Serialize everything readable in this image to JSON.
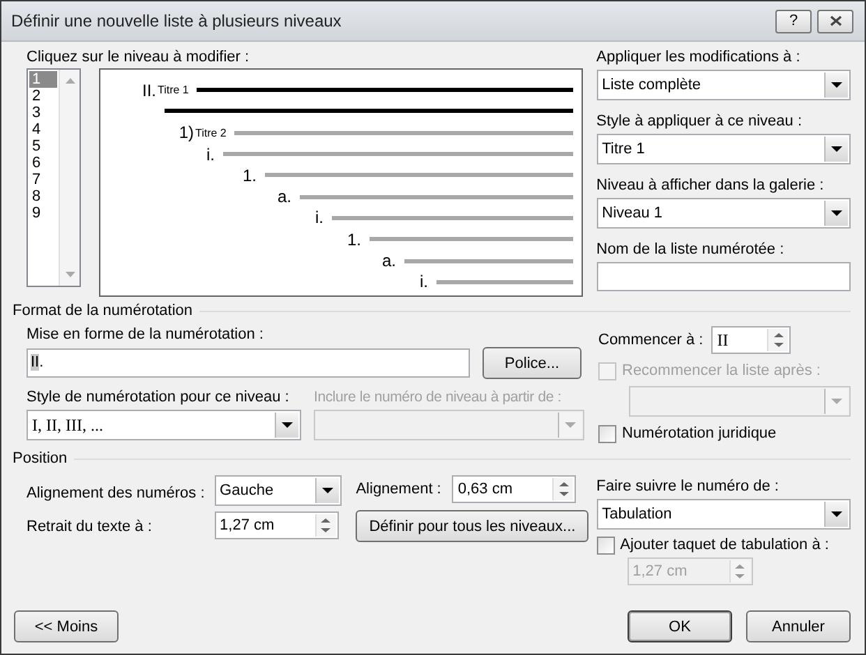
{
  "window": {
    "title": "Définir une nouvelle liste à plusieurs niveaux",
    "help": "?"
  },
  "level_list": {
    "label": "Cliquez sur le niveau à modifier :",
    "items": [
      {
        "label": "1",
        "selected": true
      },
      {
        "label": "2",
        "selected": false
      },
      {
        "label": "3",
        "selected": false
      },
      {
        "label": "4",
        "selected": false
      },
      {
        "label": "5",
        "selected": false
      },
      {
        "label": "6",
        "selected": false
      },
      {
        "label": "7",
        "selected": false
      },
      {
        "label": "8",
        "selected": false
      },
      {
        "label": "9",
        "selected": false
      }
    ]
  },
  "preview": {
    "levels": [
      {
        "number": "II.",
        "title": "Titre 1",
        "selected": true
      },
      {
        "number": "1)",
        "title": "Titre 2",
        "selected": false
      },
      {
        "number": "i.",
        "selected": false
      },
      {
        "number": "1.",
        "selected": false
      },
      {
        "number": "a.",
        "selected": false
      },
      {
        "number": "i.",
        "selected": false
      },
      {
        "number": "1.",
        "selected": false
      },
      {
        "number": "a.",
        "selected": false
      },
      {
        "number": "i.",
        "selected": false
      }
    ]
  },
  "apply_to": {
    "label": "Appliquer les modifications à :",
    "value": "Liste complète"
  },
  "level_style": {
    "label": "Style à appliquer à ce niveau :",
    "value": "Titre 1"
  },
  "gallery_level": {
    "label": "Niveau à afficher dans la galerie :",
    "value": "Niveau 1"
  },
  "list_name": {
    "label": "Nom de la liste numérotée :"
  },
  "number_format": {
    "title": "Format de la numérotation",
    "format": {
      "label": "Mise en forme de la numérotation :",
      "field": "II",
      "text": "."
    },
    "font_button": "Police...",
    "style": {
      "label": "Style de numérotation pour ce niveau :",
      "value": "I, II, III, ..."
    },
    "include": {
      "label": "Inclure le numéro de niveau à partir de :",
      "disabled": true
    },
    "start": {
      "label": "Commencer à :",
      "value": "II"
    },
    "restart": {
      "label": "Recommencer la liste après :",
      "checked": false,
      "disabled": true
    },
    "legal": {
      "label": "Numérotation juridique",
      "checked": false,
      "disabled": false
    }
  },
  "position": {
    "title": "Position",
    "number_alignment": {
      "label": "Alignement des numéros :",
      "value": "Gauche"
    },
    "alignment": {
      "label": "Alignement :",
      "value": "0,63 cm"
    },
    "text_indent": {
      "label": "Retrait du texte à :",
      "value": "1,27 cm"
    },
    "set_all_button": "Définir pour tous les niveaux...",
    "follow": {
      "label": "Faire suivre le numéro de :",
      "value": "Tabulation"
    },
    "add_tab": {
      "label": "Ajouter taquet de tabulation à :",
      "checked": false,
      "disabled": false
    },
    "tab_stop": {
      "value": "1,27 cm",
      "disabled": true
    }
  },
  "buttons": [
    {
      "label": "<< Moins",
      "default": false
    },
    {
      "label": "OK",
      "default": true
    },
    {
      "label": "Annuler",
      "default": false
    }
  ]
}
